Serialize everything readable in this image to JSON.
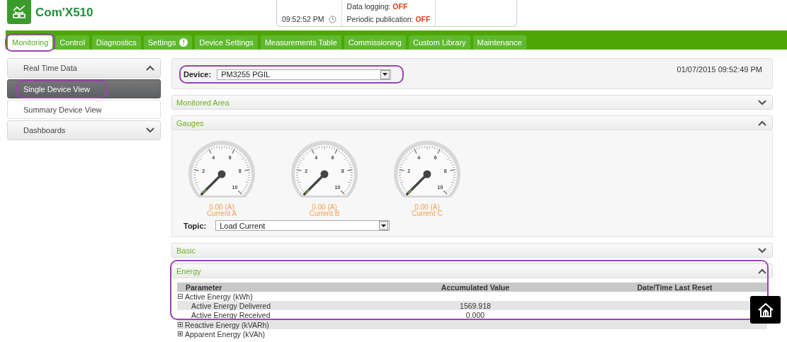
{
  "header": {
    "app_title": "Com'X510",
    "status": {
      "time": "09:52:52 PM",
      "data_logging_label": "Data logging:",
      "data_logging_value": "OFF",
      "publication_label": "Periodic publication:",
      "publication_value": "OFF"
    }
  },
  "tabs": [
    {
      "label": "Monitoring",
      "selected": true,
      "highlighted": true
    },
    {
      "label": "Control",
      "selected": false,
      "highlighted": false
    },
    {
      "label": "Diagnostics",
      "selected": false,
      "highlighted": false
    },
    {
      "label": "Settings",
      "selected": false,
      "highlighted": false,
      "badge": "!"
    },
    {
      "label": "Device Settings",
      "selected": false,
      "highlighted": false
    },
    {
      "label": "Measurements Table",
      "selected": false,
      "highlighted": false
    },
    {
      "label": "Commissioning",
      "selected": false,
      "highlighted": false
    },
    {
      "label": "Custom Library",
      "selected": false,
      "highlighted": false
    },
    {
      "label": "Maintenance",
      "selected": false,
      "highlighted": false
    }
  ],
  "sidebar": {
    "groups": [
      {
        "label": "Real Time Data",
        "expanded": true,
        "items": [
          {
            "label": "Single Device View",
            "selected": true,
            "highlighted": true
          },
          {
            "label": "Summary Device View",
            "selected": false,
            "highlighted": false
          }
        ]
      },
      {
        "label": "Dashboards",
        "expanded": false
      }
    ]
  },
  "device_panel": {
    "label": "Device:",
    "value": "PM3255 PGIL",
    "highlighted": true,
    "datetime": "01/07/2015 09:52:49 PM"
  },
  "sections": [
    {
      "kind": "plain",
      "title": "Monitored Area",
      "expanded": false,
      "highlighted": false
    },
    {
      "kind": "gauges",
      "title": "Gauges",
      "expanded": true,
      "highlighted": false,
      "topic_label": "Topic:",
      "topic_value": "Load Current",
      "gauges": [
        {
          "reading": "0.00 (A)",
          "label": "Current A",
          "scale_labels": [
            "2",
            "4",
            "6",
            "8",
            "10"
          ]
        },
        {
          "reading": "0.00 (A)",
          "label": "Current B",
          "scale_labels": [
            "2",
            "4",
            "6",
            "8",
            "10"
          ]
        },
        {
          "reading": "0.00 (A)",
          "label": "Current C",
          "scale_labels": [
            "2",
            "4",
            "6",
            "8",
            "10"
          ]
        }
      ]
    },
    {
      "kind": "plain",
      "title": "Basic",
      "expanded": false,
      "highlighted": false
    },
    {
      "kind": "energy",
      "title": "Energy",
      "expanded": true,
      "highlighted": true,
      "columns": [
        "Parameter",
        "Accumulated Value",
        "Date/Time Last Reset"
      ],
      "rows": [
        {
          "parameter": "Active Energy (kWh)",
          "expanded": true,
          "children": [
            {
              "parameter": "Active Energy Delivered",
              "value": "1569.918"
            },
            {
              "parameter": "Active Energy Received",
              "value": "0.000"
            }
          ]
        },
        {
          "parameter": "Reactive Energy (kVARh)",
          "expanded": false
        },
        {
          "parameter": "Apparent Energy (kVAh)",
          "expanded": false
        }
      ]
    }
  ]
}
